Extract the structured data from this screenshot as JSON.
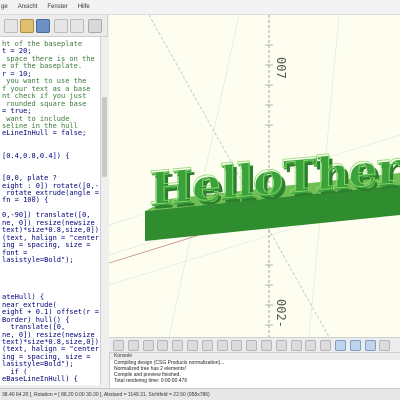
{
  "menu": [
    "ge",
    "Ansicht",
    "Fenster",
    "Hilfe"
  ],
  "editor": {
    "lines": [
      {
        "t": "ht of the baseplate",
        "c": "comment"
      },
      {
        "t": "t = 20;",
        "c": "code"
      },
      {
        "t": " space there is on the",
        "c": "comment"
      },
      {
        "t": "e of the baseplate.",
        "c": "comment"
      },
      {
        "t": "r = 10;",
        "c": "code"
      },
      {
        "t": " you want to use the",
        "c": "comment"
      },
      {
        "t": "f your text as a base",
        "c": "comment"
      },
      {
        "t": "nt check if you just",
        "c": "comment"
      },
      {
        "t": " rounded square base",
        "c": "comment"
      },
      {
        "t": "= true;",
        "c": "code"
      },
      {
        "t": " want to include",
        "c": "comment"
      },
      {
        "t": "seline in the hull",
        "c": "comment"
      },
      {
        "t": "eLineInHull = false;",
        "c": "code"
      },
      {
        "t": "",
        "c": "code"
      },
      {
        "t": "",
        "c": "code"
      },
      {
        "t": "[0.4,0.8,0.4]) {",
        "c": "code"
      },
      {
        "t": "",
        "c": "code"
      },
      {
        "t": "",
        "c": "code"
      },
      {
        "t": "[0,0, plate ?",
        "c": "code"
      },
      {
        "t": "eight : 0]) rotate([0,-",
        "c": "code"
      },
      {
        "t": " rotate_extrude(angle =",
        "c": "code"
      },
      {
        "t": "fn = 100) {",
        "c": "code"
      },
      {
        "t": "",
        "c": "code"
      },
      {
        "t": "0,-90]) translate([0,",
        "c": "code"
      },
      {
        "t": "ne, 0]) resize(newsize",
        "c": "code"
      },
      {
        "t": "text)*size*0.8,size,0])",
        "c": "code"
      },
      {
        "t": "(text, halign = \"center\"",
        "c": "code"
      },
      {
        "t": "ing = spacing, size =",
        "c": "code"
      },
      {
        "t": "font =",
        "c": "code"
      },
      {
        "t": "lasistyle=Bold\");",
        "c": "code"
      },
      {
        "t": "",
        "c": "code"
      },
      {
        "t": "",
        "c": "code"
      },
      {
        "t": "",
        "c": "code"
      },
      {
        "t": "",
        "c": "code"
      },
      {
        "t": "ateHull) {",
        "c": "code"
      },
      {
        "t": "near_extrude(",
        "c": "code"
      },
      {
        "t": "eight + 0.1) offset(r =",
        "c": "code"
      },
      {
        "t": "Border) hull() {",
        "c": "code"
      },
      {
        "t": "  translate([0,",
        "c": "code"
      },
      {
        "t": "ne, 0]) resize(newsize",
        "c": "code"
      },
      {
        "t": "text)*size*0.8,size,0])",
        "c": "code"
      },
      {
        "t": "(text, halign = \"center\"",
        "c": "code"
      },
      {
        "t": "ing = spacing, size =",
        "c": "code"
      },
      {
        "t": "lasistyle=Bold\");",
        "c": "code"
      },
      {
        "t": "  if (",
        "c": "code"
      },
      {
        "t": "eBaseLineInHull) {",
        "c": "code"
      }
    ]
  },
  "viewport": {
    "model_text": "HelloThere",
    "axis_labels": [
      "007",
      "002-"
    ],
    "colors": {
      "model_face": "#39a33a",
      "model_top": "#7fcf64",
      "model_dark": "#2c7f2c",
      "background": "#fdfdf0"
    }
  },
  "console": {
    "title": "Konsole",
    "lines": [
      "Compiling design (CSG Products normalization)...",
      "Normalized tree has 2 elements!",
      "Compile and preview finished.",
      "Total rendering time: 0:00:00.476"
    ]
  },
  "statusbar": {
    "text": "38.40 64.20 ], Rotation = [ 88.20 0.00 30.30 ], Abstand = 1149.31, Sichtfeld = 22.50 (958x786)"
  }
}
